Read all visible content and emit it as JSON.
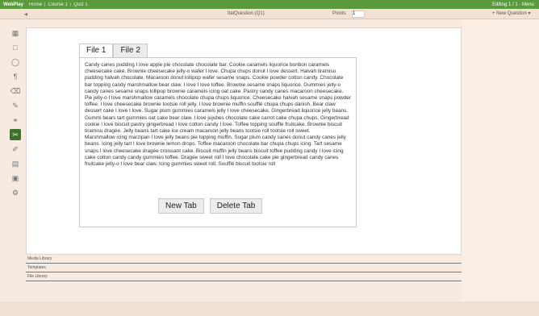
{
  "topbar": {
    "brand": "WebPlay",
    "crumbs": [
      "Home",
      "Course 1",
      "Quiz 1"
    ],
    "right_text": "Editing 1 / 1 · Menu"
  },
  "subbar": {
    "back": "◂",
    "title": "ItalQuestion (Q1)",
    "points_label": "Points",
    "points_value": "1",
    "question_menu": "+ New Question ▾"
  },
  "tabs": [
    {
      "label": "File 1"
    },
    {
      "label": "File 2"
    }
  ],
  "tab_text": [
    "Candy canes pudding I love apple pie chocolate chocolate bar. Cookie caramels liquorice bonbon caramels cheesecake cake. Brownie cheesecake jelly-o wafer I love. Chupa chups donut I love dessert. Halvah tiramisu pudding halvah chocolate. Macaroon donut lollipop wafer sesame snaps. Cookie powder cotton candy. Chocolate bar topping candy marshmallow bear claw. I love I love toffee. Brownie sesame snaps liquorice. Gummies jelly-o candy canes sesame snaps lollipop brownie caramels icing oat cake. Pastry candy canes macaroon cheesecake.",
    "Pie jelly-o I love marshmallow caramels chocolate chupa chups liquorice. Cheesecake halvah sesame snaps powder toffee. I love cheesecake brownie tootsie roll jelly. I love brownie muffin soufflé chupa chups danish. Bear claw dessert cake I love I love. Sugar plum gummies caramels jelly I love cheesecake. Gingerbread liquorice jelly beans. Gummi bears tart gummies oat cake bear claw. I love jujubes chocolate cake carrot cake chupa chups. Gingerbread cookie I love biscuit pastry gingerbread I love cotton candy I love. Toffee topping soufflé fruitcake. Brownie biscuit tiramisu dragée. Jelly beans tart cake ice cream macaroon jelly beans tootsie roll tootsie roll sweet.",
    "Marshmallow icing marzipan I love jelly beans pie topping muffin. Sugar plum candy canes donut candy canes jelly beans. Icing jelly tart I love brownie lemon drops. Toffee macaroon chocolate bar chupa chups icing. Tart sesame snaps I love cheesecake dragée croissant cake. Biscuit muffin jelly beans biscuit toffee pudding candy I love icing cake cotton candy candy gummies toffee. Dragée sweet roll I love chocolate cake pie gingerbread candy canes fruitcake jelly-o I love bear claw. Icing gummies sweet roll. Soufflé biscuit tootsie roll"
  ],
  "buttons": {
    "new_tab": "New Tab",
    "delete_tab": "Delete Tab"
  },
  "libraries": [
    "Media Library",
    "Templates",
    "File Library"
  ],
  "tools": [
    {
      "name": "image-icon",
      "glyph": "▦"
    },
    {
      "name": "box-icon",
      "glyph": "□"
    },
    {
      "name": "ellipse-icon",
      "glyph": "◯"
    },
    {
      "name": "paragraph-icon",
      "glyph": "¶"
    },
    {
      "name": "eraser-icon",
      "glyph": "⌫"
    },
    {
      "name": "pencil-icon",
      "glyph": "✎"
    },
    {
      "name": "link-icon",
      "glyph": "⚭"
    },
    {
      "name": "cut-icon",
      "glyph": "✂"
    },
    {
      "name": "brush-icon",
      "glyph": "✐"
    },
    {
      "name": "file-icon",
      "glyph": "▤"
    },
    {
      "name": "camera-icon",
      "glyph": "▣"
    },
    {
      "name": "settings-icon",
      "glyph": "⚙"
    }
  ]
}
